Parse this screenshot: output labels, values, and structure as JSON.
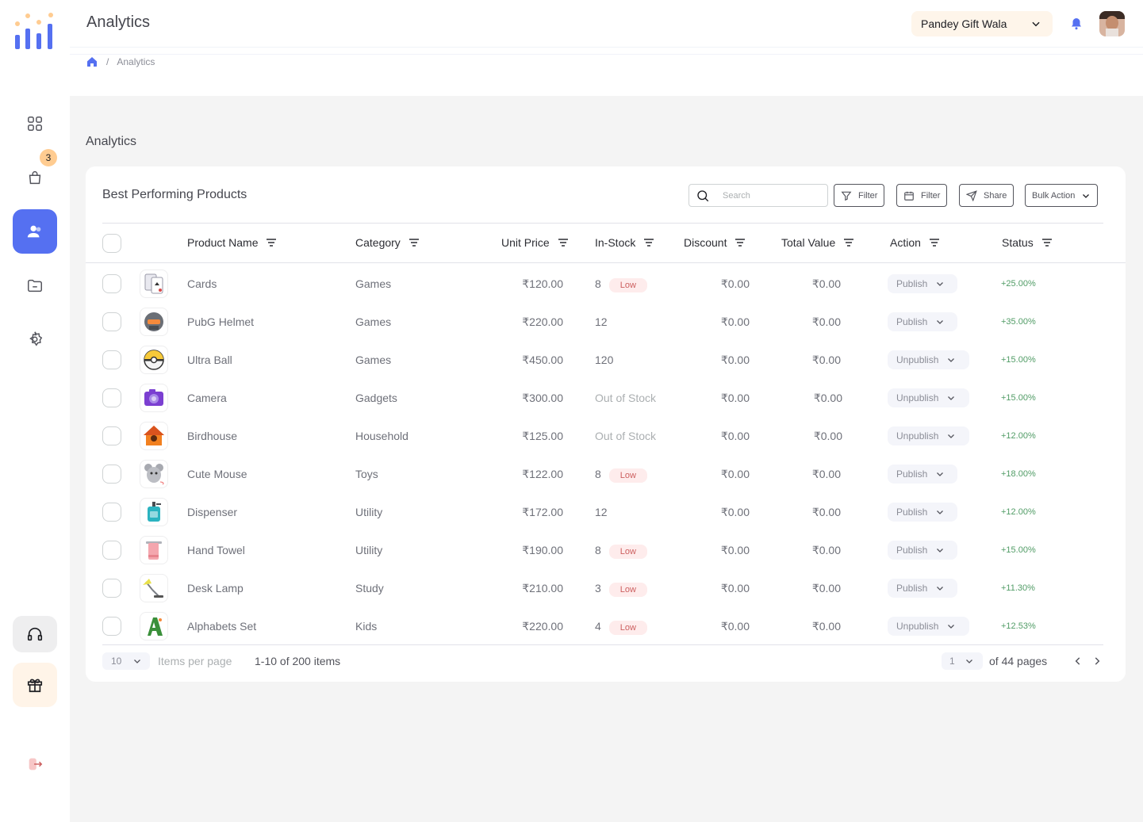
{
  "header": {
    "title": "Analytics",
    "shop_name": "Pandey Gift Wala"
  },
  "breadcrumb": {
    "current": "Analytics",
    "separator": "/"
  },
  "sidebar": {
    "cart_badge": "3"
  },
  "main": {
    "section_title": "Analytics"
  },
  "card": {
    "title": "Best Performing Products",
    "search_placeholder": "Search",
    "filter_label": "Filter",
    "date_filter_label": "Filter",
    "share_label": "Share",
    "bulk_action_label": "Bulk Action"
  },
  "table": {
    "columns": [
      "Product Name",
      "Category",
      "Unit Price",
      "In-Stock",
      "Discount",
      "Total Value",
      "Action",
      "Status"
    ],
    "rows": [
      {
        "name": "Cards",
        "category": "Games",
        "price": "₹120.00",
        "stock": "8",
        "low": "Low",
        "discount": "₹0.00",
        "total": "₹0.00",
        "action": "Publish",
        "status": "+25.00%",
        "icon": "cards-icon"
      },
      {
        "name": "PubG Helmet",
        "category": "Games",
        "price": "₹220.00",
        "stock": "12",
        "low": "",
        "discount": "₹0.00",
        "total": "₹0.00",
        "action": "Publish",
        "status": "+35.00%",
        "icon": "helmet-icon"
      },
      {
        "name": "Ultra Ball",
        "category": "Games",
        "price": "₹450.00",
        "stock": "120",
        "low": "",
        "discount": "₹0.00",
        "total": "₹0.00",
        "action": "Unpublish",
        "status": "+15.00%",
        "icon": "ball-icon"
      },
      {
        "name": "Camera",
        "category": "Gadgets",
        "price": "₹300.00",
        "stock": "Out of Stock",
        "low": "",
        "discount": "₹0.00",
        "total": "₹0.00",
        "action": "Unpublish",
        "status": "+15.00%",
        "icon": "camera-icon"
      },
      {
        "name": "Birdhouse",
        "category": "Household",
        "price": "₹125.00",
        "stock": "Out of Stock",
        "low": "",
        "discount": "₹0.00",
        "total": "₹0.00",
        "action": "Unpublish",
        "status": "+12.00%",
        "icon": "birdhouse-icon"
      },
      {
        "name": "Cute Mouse",
        "category": "Toys",
        "price": "₹122.00",
        "stock": "8",
        "low": "Low",
        "discount": "₹0.00",
        "total": "₹0.00",
        "action": "Publish",
        "status": "+18.00%",
        "icon": "mouse-toy-icon"
      },
      {
        "name": "Dispenser",
        "category": "Utility",
        "price": "₹172.00",
        "stock": "12",
        "low": "",
        "discount": "₹0.00",
        "total": "₹0.00",
        "action": "Publish",
        "status": "+12.00%",
        "icon": "dispenser-icon"
      },
      {
        "name": "Hand Towel",
        "category": "Utility",
        "price": "₹190.00",
        "stock": "8",
        "low": "Low",
        "discount": "₹0.00",
        "total": "₹0.00",
        "action": "Publish",
        "status": "+15.00%",
        "icon": "towel-icon"
      },
      {
        "name": "Desk Lamp",
        "category": "Study",
        "price": "₹210.00",
        "stock": "3",
        "low": "Low",
        "discount": "₹0.00",
        "total": "₹0.00",
        "action": "Publish",
        "status": "+11.30%",
        "icon": "lamp-icon"
      },
      {
        "name": "Alphabets Set",
        "category": "Kids",
        "price": "₹220.00",
        "stock": "4",
        "low": "Low",
        "discount": "₹0.00",
        "total": "₹0.00",
        "action": "Unpublish",
        "status": "+12.53%",
        "icon": "alphabet-icon"
      }
    ]
  },
  "footer": {
    "per_page": "10",
    "per_page_label": "Items per page",
    "range": "1-10 of 200 items",
    "page": "1",
    "of_pages": "of 44 pages"
  },
  "colors": {
    "accent": "#5570f1",
    "badge": "#ffcc91",
    "positive": "#519c66",
    "low": "#cc5f5f"
  }
}
